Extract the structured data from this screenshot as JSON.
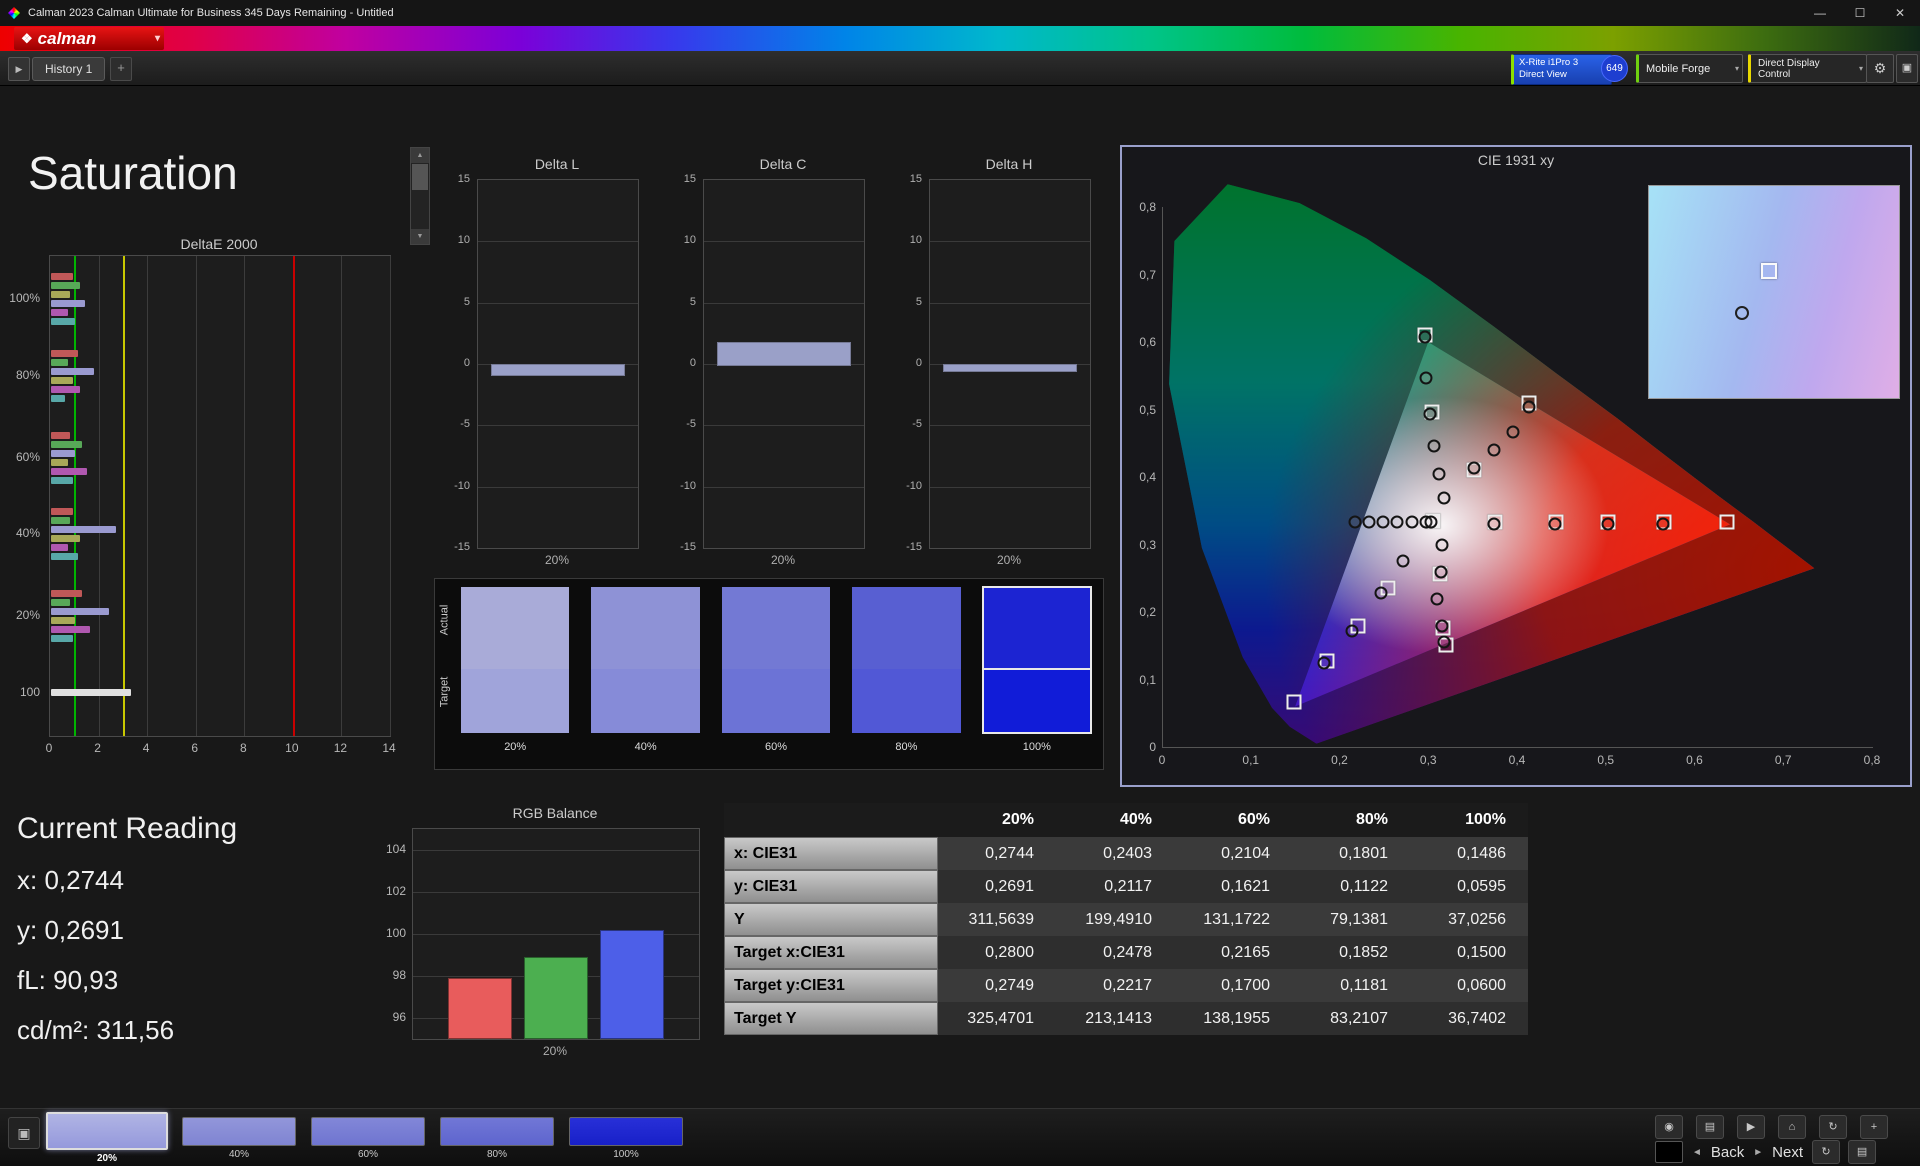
{
  "window": {
    "title": "Calman 2023 Calman Ultimate for Business 345 Days Remaining  - Untitled"
  },
  "icons": {
    "caret": "▾",
    "up": "▲",
    "down": "▼",
    "right": "▶",
    "gear": "⚙",
    "diamond": "❖",
    "panel": "▣",
    "minimize": "—",
    "maximize": "☐",
    "close": "✕",
    "back": "◄",
    "next": "►"
  },
  "logo": {
    "text": "calman"
  },
  "toolbar": {
    "history_tab": "History 1",
    "add_tab": "+",
    "meter_button": {
      "line1": "X-Rite i1Pro 3",
      "line2": "Direct View"
    },
    "meter_badge": "649",
    "source_button": "Mobile Forge",
    "display_button": "Direct Display Control"
  },
  "page": {
    "title": "Saturation"
  },
  "swatch_panel": {
    "row_labels": [
      "Actual",
      "Target"
    ],
    "items": [
      {
        "label": "20%",
        "actual": "#a9abd8",
        "target": "#a0a4da"
      },
      {
        "label": "40%",
        "actual": "#8e92d6",
        "target": "#868bd8"
      },
      {
        "label": "60%",
        "actual": "#7379d4",
        "target": "#6c73d6"
      },
      {
        "label": "80%",
        "actual": "#585fd2",
        "target": "#5158d6"
      },
      {
        "label": "100%",
        "actual": "#1c24d2",
        "target": "#111cd8",
        "selected": true
      }
    ]
  },
  "current_reading": {
    "title": "Current Reading",
    "lines": [
      "x: 0,2744",
      "y: 0,2691",
      "fL: 90,93",
      "cd/m²: 311,56"
    ]
  },
  "bottom_bar": {
    "pattern_button_icon": "▣",
    "swatches": [
      {
        "label": "20%",
        "color1": "#b0b4e4",
        "color2": "#9599dc",
        "selected": true
      },
      {
        "label": "40%",
        "color1": "#9296da",
        "color2": "#7f84d2"
      },
      {
        "label": "60%",
        "color1": "#8287d8",
        "color2": "#6f75d0"
      },
      {
        "label": "80%",
        "color1": "#7177d6",
        "color2": "#5e65ce"
      },
      {
        "label": "100%",
        "color1": "#2830d8",
        "color2": "#1820c8"
      }
    ],
    "row1_icons": [
      {
        "name": "meter-icon",
        "glyph": "◉"
      },
      {
        "name": "pattern-icon",
        "glyph": "▤"
      },
      {
        "name": "play-icon",
        "glyph": "▶"
      },
      {
        "name": "home-icon",
        "glyph": "⌂"
      },
      {
        "name": "refresh-icon",
        "glyph": "↻"
      },
      {
        "name": "add-icon",
        "glyph": "+"
      }
    ],
    "back_label": "Back",
    "next_label": "Next",
    "end_icons": [
      {
        "name": "redo-icon",
        "glyph": "↻"
      },
      {
        "name": "list-icon",
        "glyph": "▤"
      }
    ]
  },
  "chart_data": [
    {
      "type": "bar",
      "title": "DeltaE 2000",
      "orientation": "horizontal",
      "xlim": [
        0,
        14
      ],
      "x_ticks": [
        0,
        2,
        4,
        6,
        8,
        10,
        12,
        14
      ],
      "reference_lines": [
        {
          "value": 1,
          "color": "#00b400"
        },
        {
          "value": 3,
          "color": "#c8c800"
        },
        {
          "value": 10,
          "color": "#c80000"
        }
      ],
      "groups": [
        {
          "label": "100%",
          "center": 9,
          "bars": [
            {
              "value": 0.9,
              "color": "#c05858"
            },
            {
              "value": 1.2,
              "color": "#58a858"
            },
            {
              "value": 0.8,
              "color": "#a8a858"
            },
            {
              "value": 1.4,
              "color": "#9a9ad0"
            },
            {
              "value": 0.7,
              "color": "#b058b0"
            },
            {
              "value": 1.0,
              "color": "#58a8a8"
            }
          ]
        },
        {
          "label": "80%",
          "center": 25,
          "bars": [
            {
              "value": 1.1,
              "color": "#c05858"
            },
            {
              "value": 0.7,
              "color": "#58a858"
            },
            {
              "value": 1.8,
              "color": "#9a9ad0"
            },
            {
              "value": 0.9,
              "color": "#a8a858"
            },
            {
              "value": 1.2,
              "color": "#b058b0"
            },
            {
              "value": 0.6,
              "color": "#58a8a8"
            }
          ]
        },
        {
          "label": "60%",
          "center": 42,
          "bars": [
            {
              "value": 0.8,
              "color": "#c05858"
            },
            {
              "value": 1.3,
              "color": "#58a858"
            },
            {
              "value": 1.0,
              "color": "#9a9ad0"
            },
            {
              "value": 0.7,
              "color": "#a8a858"
            },
            {
              "value": 1.5,
              "color": "#b058b0"
            },
            {
              "value": 0.9,
              "color": "#58a8a8"
            }
          ]
        },
        {
          "label": "40%",
          "center": 58,
          "bars": [
            {
              "value": 0.9,
              "color": "#c05858"
            },
            {
              "value": 0.8,
              "color": "#58a858"
            },
            {
              "value": 2.7,
              "color": "#9a9ad0"
            },
            {
              "value": 1.2,
              "color": "#a8a858"
            },
            {
              "value": 0.7,
              "color": "#b058b0"
            },
            {
              "value": 1.1,
              "color": "#58a8a8"
            }
          ]
        },
        {
          "label": "20%",
          "center": 75,
          "bars": [
            {
              "value": 1.3,
              "color": "#c05858"
            },
            {
              "value": 0.8,
              "color": "#58a858"
            },
            {
              "value": 2.4,
              "color": "#9a9ad0"
            },
            {
              "value": 1.0,
              "color": "#a8a858"
            },
            {
              "value": 1.6,
              "color": "#b058b0"
            },
            {
              "value": 0.9,
              "color": "#58a8a8"
            }
          ]
        },
        {
          "label": "100",
          "center": 91,
          "bars": [
            {
              "value": 3.3,
              "color": "#e0e0e0"
            }
          ]
        }
      ]
    },
    {
      "type": "bar",
      "title": "Delta L",
      "ylim": [
        -15,
        15
      ],
      "y_ticks": [
        15,
        10,
        5,
        0,
        -5,
        -10,
        -15
      ],
      "categories": [
        "20%"
      ],
      "values": [
        -0.8
      ],
      "bar_color": "#9aa0c8"
    },
    {
      "type": "bar",
      "title": "Delta C",
      "ylim": [
        -15,
        15
      ],
      "y_ticks": [
        15,
        10,
        5,
        0,
        -5,
        -10,
        -15
      ],
      "categories": [
        "20%"
      ],
      "values": [
        1.8
      ],
      "bar_color": "#9aa0c8"
    },
    {
      "type": "bar",
      "title": "Delta H",
      "ylim": [
        -15,
        15
      ],
      "y_ticks": [
        15,
        10,
        5,
        0,
        -5,
        -10,
        -15
      ],
      "categories": [
        "20%"
      ],
      "values": [
        -0.5
      ],
      "bar_color": "#9aa0c8"
    },
    {
      "type": "scatter",
      "title": "CIE 1931 xy",
      "xlim": [
        0,
        0.8
      ],
      "ylim": [
        0,
        0.8
      ],
      "x_tick_values": [
        0,
        0.1,
        0.2,
        0.3,
        0.4,
        0.5,
        0.6,
        0.7,
        0.8
      ],
      "x_tick_labels": [
        "0",
        "0,1",
        "0,2",
        "0,3",
        "0,4",
        "0,5",
        "0,6",
        "0,7",
        "0,8"
      ],
      "y_tick_values": [
        0,
        0.1,
        0.2,
        0.3,
        0.4,
        0.5,
        0.6,
        0.7,
        0.8
      ],
      "y_tick_labels": [
        "0",
        "0,1",
        "0,2",
        "0,3",
        "0,4",
        "0,5",
        "0,6",
        "0,7",
        "0,8"
      ],
      "measured": [
        [
          0.217,
          0.333
        ],
        [
          0.233,
          0.333
        ],
        [
          0.249,
          0.333
        ],
        [
          0.265,
          0.333
        ],
        [
          0.282,
          0.333
        ],
        [
          0.298,
          0.333
        ],
        [
          0.303,
          0.333
        ],
        [
          0.296,
          0.607
        ],
        [
          0.298,
          0.547
        ],
        [
          0.302,
          0.494
        ],
        [
          0.307,
          0.446
        ],
        [
          0.312,
          0.405
        ],
        [
          0.318,
          0.369
        ],
        [
          0.351,
          0.413
        ],
        [
          0.374,
          0.44
        ],
        [
          0.395,
          0.466
        ],
        [
          0.413,
          0.503
        ],
        [
          0.374,
          0.331
        ],
        [
          0.443,
          0.331
        ],
        [
          0.502,
          0.331
        ],
        [
          0.565,
          0.331
        ],
        [
          0.316,
          0.299
        ],
        [
          0.314,
          0.259
        ],
        [
          0.31,
          0.219
        ],
        [
          0.315,
          0.179
        ],
        [
          0.318,
          0.155
        ],
        [
          0.271,
          0.275
        ],
        [
          0.247,
          0.228
        ],
        [
          0.214,
          0.172
        ],
        [
          0.183,
          0.125
        ]
      ],
      "targets": [
        [
          0.305,
          0.335
        ],
        [
          0.375,
          0.334
        ],
        [
          0.444,
          0.334
        ],
        [
          0.503,
          0.334
        ],
        [
          0.566,
          0.334
        ],
        [
          0.637,
          0.334
        ],
        [
          0.352,
          0.41
        ],
        [
          0.414,
          0.509
        ],
        [
          0.296,
          0.61
        ],
        [
          0.304,
          0.497
        ],
        [
          0.313,
          0.257
        ],
        [
          0.317,
          0.176
        ],
        [
          0.32,
          0.151
        ],
        [
          0.255,
          0.236
        ],
        [
          0.221,
          0.18
        ],
        [
          0.186,
          0.128
        ],
        [
          0.149,
          0.067
        ]
      ],
      "inset": {
        "circle": [
          0.37,
          0.6
        ],
        "square": [
          0.48,
          0.4
        ]
      }
    },
    {
      "type": "bar",
      "title": "RGB Balance",
      "ylim": [
        95,
        105
      ],
      "y_ticks": [
        104,
        102,
        100,
        98,
        96
      ],
      "categories": [
        "R",
        "G",
        "B"
      ],
      "values": [
        97.9,
        98.9,
        100.2
      ],
      "colors": [
        "#e85c5c",
        "#4caf50",
        "#4d5fe8"
      ],
      "xlabel": "20%"
    },
    {
      "type": "table",
      "columns": [
        "20%",
        "40%",
        "60%",
        "80%",
        "100%"
      ],
      "rows": [
        {
          "label": "x: CIE31",
          "values": [
            "0,2744",
            "0,2403",
            "0,2104",
            "0,1801",
            "0,1486"
          ]
        },
        {
          "label": "y: CIE31",
          "values": [
            "0,2691",
            "0,2117",
            "0,1621",
            "0,1122",
            "0,0595"
          ]
        },
        {
          "label": "Y",
          "values": [
            "311,5639",
            "199,4910",
            "131,1722",
            "79,1381",
            "37,0256"
          ]
        },
        {
          "label": "Target x:CIE31",
          "values": [
            "0,2800",
            "0,2478",
            "0,2165",
            "0,1852",
            "0,1500"
          ]
        },
        {
          "label": "Target y:CIE31",
          "values": [
            "0,2749",
            "0,2217",
            "0,1700",
            "0,1181",
            "0,0600"
          ]
        },
        {
          "label": "Target Y",
          "values": [
            "325,4701",
            "213,1413",
            "138,1955",
            "83,2107",
            "36,7402"
          ]
        }
      ]
    }
  ]
}
